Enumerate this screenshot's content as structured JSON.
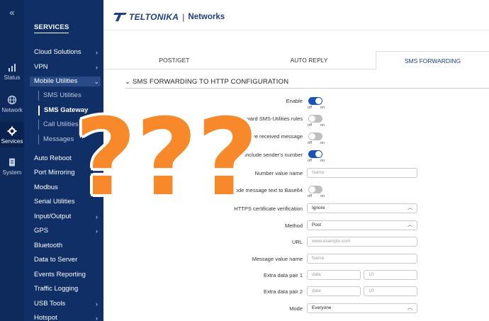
{
  "rail": {
    "items": [
      {
        "label": "Status",
        "icon": "status-bars-icon"
      },
      {
        "label": "Network",
        "icon": "globe-icon"
      },
      {
        "label": "Services",
        "icon": "gear-icon"
      },
      {
        "label": "System",
        "icon": "document-icon"
      }
    ],
    "collapse": "«"
  },
  "sidebar": {
    "heading": "SERVICES",
    "items": [
      {
        "label": "Cloud Solutions",
        "chevron": "›"
      },
      {
        "label": "VPN",
        "chevron": "›"
      },
      {
        "label": "Mobile Utilities",
        "chevron": "⌄"
      },
      {
        "label": "SMS Utilities"
      },
      {
        "label": "SMS Gateway"
      },
      {
        "label": "Call Utilities"
      },
      {
        "label": "Messages"
      },
      {
        "label": "Auto Reboot"
      },
      {
        "label": "Port Mirroring"
      },
      {
        "label": "Modbus"
      },
      {
        "label": "Serial Utilities"
      },
      {
        "label": "Input/Output",
        "chevron": "›"
      },
      {
        "label": "GPS",
        "chevron": "›"
      },
      {
        "label": "Bluetooth"
      },
      {
        "label": "Data to Server"
      },
      {
        "label": "Events Reporting"
      },
      {
        "label": "Traffic Logging"
      },
      {
        "label": "USB Tools",
        "chevron": "›"
      },
      {
        "label": "Hotspot",
        "chevron": "›"
      }
    ]
  },
  "header": {
    "brand": "TELTONIKA",
    "separator": "|",
    "product": "Networks"
  },
  "tabs": [
    {
      "label": "POST/GET"
    },
    {
      "label": "AUTO REPLY"
    },
    {
      "label": "SMS FORWARDING"
    }
  ],
  "section": {
    "chevron": "⌄",
    "title": "SMS FORWARDING TO HTTP CONFIGURATION"
  },
  "toggle_text": {
    "off": "off",
    "on": "on"
  },
  "form": {
    "enable": {
      "label": "Enable",
      "on": true
    },
    "forward_rules": {
      "label": "Forward SMS-Utilities rules",
      "on": false
    },
    "dont_save": {
      "label": "n't save received message",
      "on": false
    },
    "include_sender": {
      "label": "Include sender's number",
      "on": true
    },
    "number_value_name": {
      "label": "Number value name",
      "placeholder": "Name"
    },
    "encode_base64": {
      "label": "Encode message text to Base64",
      "on": false
    },
    "https_verify": {
      "label": "HTTPS certificate verification",
      "value": "Ignore"
    },
    "method": {
      "label": "Method",
      "value": "Post"
    },
    "url": {
      "label": "URL",
      "placeholder": "www.example.com"
    },
    "message_value_name": {
      "label": "Message value name",
      "placeholder": "Name"
    },
    "extra1": {
      "label": "Extra data pair 1",
      "key_placeholder": "data",
      "val_placeholder": "10"
    },
    "extra2": {
      "label": "Extra data pair 2",
      "key_placeholder": "data",
      "val_placeholder": "10"
    },
    "mode": {
      "label": "Mode",
      "value": "Everyone"
    }
  },
  "overlay": {
    "marks": [
      "?",
      "?",
      "?"
    ]
  },
  "colors": {
    "rail_bg": "#0e2a5c",
    "sidebar_bg": "#102f66",
    "accent": "#1a52b8",
    "brand": "#1e3e86",
    "overlay_orange": "#f7892b"
  }
}
